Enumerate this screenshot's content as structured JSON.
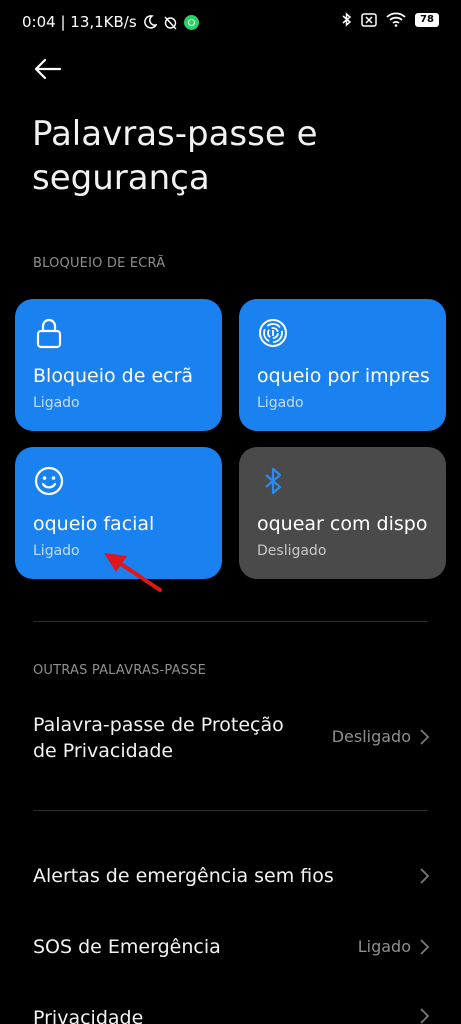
{
  "status_bar": {
    "time_speed": "0:04 | 13,1KB/s",
    "battery": "78"
  },
  "header": {
    "title": "Palavras-passe e segurança"
  },
  "screen_lock_section": {
    "label": "BLOQUEIO DE ECRÃ",
    "tiles": [
      {
        "name": "Bloqueio de ecrã",
        "state": "Ligado",
        "icon": "lock-icon",
        "active": true
      },
      {
        "name": "oqueio por impres",
        "state": "Ligado",
        "icon": "fingerprint-icon",
        "active": true
      },
      {
        "name": "oqueio facial",
        "state": "Ligado",
        "icon": "face-icon",
        "active": true
      },
      {
        "name": "oquear com dispo",
        "state": "Desligado",
        "icon": "bluetooth-icon",
        "active": false
      }
    ]
  },
  "other_passwords_section": {
    "label": "OUTRAS PALAVRAS-PASSE",
    "privacy_password": {
      "name_line1": "Palavra-passe de Proteção",
      "name_line2": "de Privacidade",
      "value": "Desligado"
    }
  },
  "list": {
    "emergency_alerts": {
      "name": "Alertas de emergência sem fios"
    },
    "sos": {
      "name": "SOS de Emergência",
      "value": "Ligado"
    },
    "privacy": {
      "name": "Privacidade"
    }
  },
  "colors": {
    "accent": "#1a82f0",
    "tile_off": "#4a4a4a",
    "annotation_arrow": "#e0161b"
  }
}
